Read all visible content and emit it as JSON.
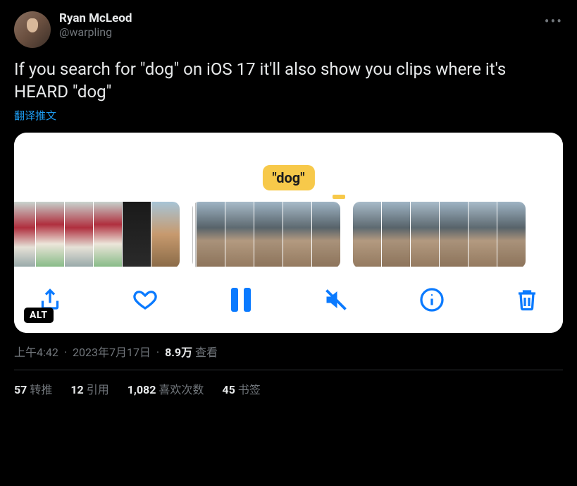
{
  "user": {
    "display_name": "Ryan McLeod",
    "handle": "@warpling"
  },
  "tweet_text": "If you search for \"dog\" on iOS 17 it'll also show you clips where it's HEARD \"dog\"",
  "translate_label": "翻译推文",
  "media": {
    "keyword_badge": "\"dog\"",
    "alt_badge": "ALT"
  },
  "meta": {
    "time": "上午4:42",
    "date": "2023年7月17日",
    "views_count": "8.9万",
    "views_label": "查看"
  },
  "engagement": {
    "retweets": {
      "count": "57",
      "label": "转推"
    },
    "quotes": {
      "count": "12",
      "label": "引用"
    },
    "likes": {
      "count": "1,082",
      "label": "喜欢次数"
    },
    "bookmarks": {
      "count": "45",
      "label": "书签"
    }
  }
}
